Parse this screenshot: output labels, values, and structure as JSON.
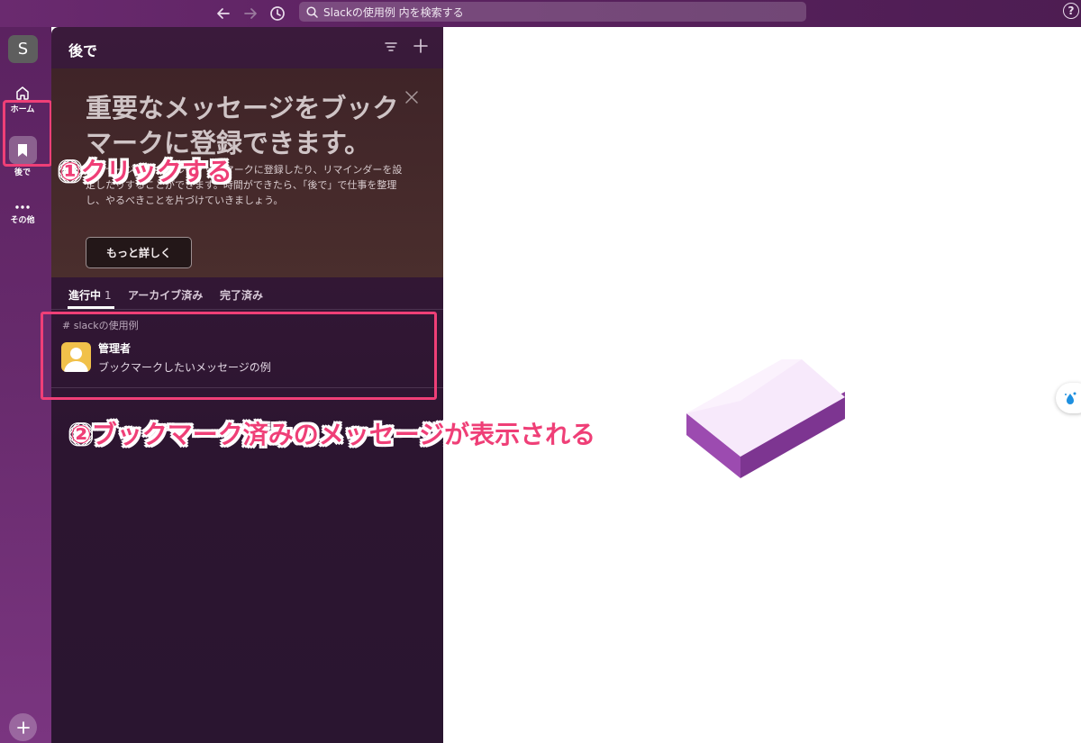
{
  "topbar": {
    "back_icon": "arrow-left-icon",
    "forward_icon": "arrow-right-icon",
    "history_icon": "clock-icon",
    "search_placeholder": "Slackの使用例 内を検索する",
    "help_label": "?"
  },
  "rail": {
    "workspace_initial": "S",
    "items": [
      {
        "label": "ホーム",
        "icon": "home-icon"
      },
      {
        "label": "後で",
        "icon": "bookmark-icon"
      },
      {
        "label": "その他",
        "icon": "more-icon"
      }
    ],
    "add_label": "+"
  },
  "panel": {
    "title": "後で",
    "promo": {
      "title": "重要なメッセージをブックマークに登録できます。",
      "body": "メッセージやファイルをブックマークに登録したり、リマインダーを設定したりすることができます。時間ができたら、「後で」で仕事を整理し、やるべきことを片づけていきましょう。",
      "button": "もっと詳しく"
    },
    "tabs": [
      {
        "label": "進行中",
        "count": "1"
      },
      {
        "label": "アーカイブ済み"
      },
      {
        "label": "完了済み"
      }
    ],
    "channel": "# slackの使用例",
    "message": {
      "author": "管理者",
      "text": "ブックマークしたいメッセージの例"
    }
  },
  "annotations": {
    "step1": "①クリックする",
    "step2": "②ブックマーク済みのメッセージが表示される"
  },
  "colors": {
    "accent": "#ef3f77",
    "rail": "#682b6d",
    "panel": "#2c1530"
  }
}
